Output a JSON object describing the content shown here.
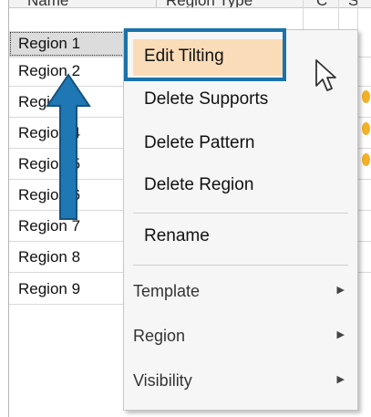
{
  "grid": {
    "columns": [
      "Name",
      "Region Type",
      "C",
      "S"
    ],
    "rows": [
      "Region 1",
      "Region 2",
      "Region 3",
      "Region 4",
      "Region 5",
      "Region 6",
      "Region 7",
      "Region 8",
      "Region 9"
    ],
    "selected_row": "Region 1"
  },
  "context_menu": {
    "items": [
      "Edit Tilting",
      "Delete Supports",
      "Delete Pattern",
      "Delete Region",
      "Rename"
    ],
    "submenus": [
      "Template",
      "Region",
      "Visibility"
    ],
    "highlighted": "Edit Tilting"
  },
  "colors": {
    "highlight_border": "#1b73a8",
    "hover_fill": "#fbdcb8",
    "arrow_fill": "#1f77b4",
    "warning_icon": "#f3b125"
  },
  "icons": {
    "arrow": "up-arrow-icon",
    "cursor": "mouse-pointer-icon",
    "submenu": "chevron-right-icon",
    "warning": "warning-dot-icon"
  }
}
